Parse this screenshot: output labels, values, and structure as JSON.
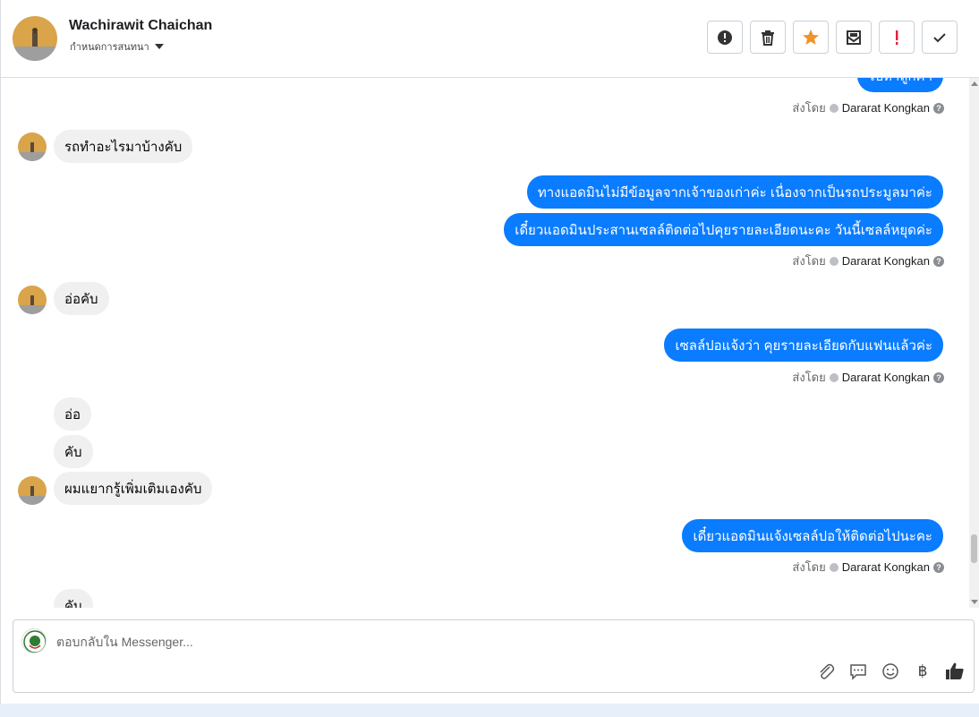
{
  "header": {
    "name": "Wachirawit Chaichan",
    "subtitle": "กำหนดการสนทนา",
    "actions": [
      {
        "icon": "exclamation-circle-icon",
        "label": "mark-spam"
      },
      {
        "icon": "trash-icon",
        "label": "delete"
      },
      {
        "icon": "star-icon",
        "label": "star",
        "color": "#f0932b"
      },
      {
        "icon": "envelope-icon",
        "label": "mark-unread"
      },
      {
        "icon": "exclamation-red-icon",
        "label": "important",
        "color": "#e41e3f"
      },
      {
        "icon": "check-icon",
        "label": "done"
      }
    ]
  },
  "thread": {
    "partial_top_message": "ไปหาลูกค้า",
    "messages": [
      {
        "dir": "in",
        "text": "รถทำอะไรมาบ้างคับ"
      },
      {
        "dir": "out",
        "text": "ทางแอดมินไม่มีข้อมูลจากเจ้าของเก่าค่ะ เนื่องจากเป็นรถประมูลมาค่ะ"
      },
      {
        "dir": "out",
        "text": "เดี๋ยวแอดมินประสานเซลล์ติดต่อไปคุยรายละเอียดนะคะ วันนี้เซลล์หยุดค่ะ"
      },
      {
        "dir": "in",
        "text": "อ่อคับ"
      },
      {
        "dir": "out",
        "text": "เซลล์ปอแจ้งว่า คุยรายละเอียดกับแฟนแล้วค่ะ"
      },
      {
        "dir": "in",
        "text": "อ่อ"
      },
      {
        "dir": "in",
        "text": "คับ"
      },
      {
        "dir": "in",
        "text": "ผมแยากรู้เพิ่มเติมเองคับ"
      },
      {
        "dir": "out",
        "text": "เดี๋ยวแอดมินแจ้งเซลล์ปอให้ติดต่อไปนะคะ"
      },
      {
        "dir": "in",
        "text": "คับ"
      }
    ],
    "sent_by_prefix": "ส่งโดย",
    "sent_by_name": "Dararat Kongkan",
    "sent_by_help": "?"
  },
  "composer": {
    "placeholder": "ตอบกลับใน Messenger...",
    "value": "",
    "tools": [
      "paperclip-icon",
      "chat-bubbles-icon",
      "smiley-icon",
      "baht-icon",
      "thumbs-up-icon"
    ],
    "baht_symbol": "฿"
  },
  "colors": {
    "outgoing": "#0a7cff",
    "incoming": "#f0f0f0",
    "strip": "#e7effb"
  }
}
